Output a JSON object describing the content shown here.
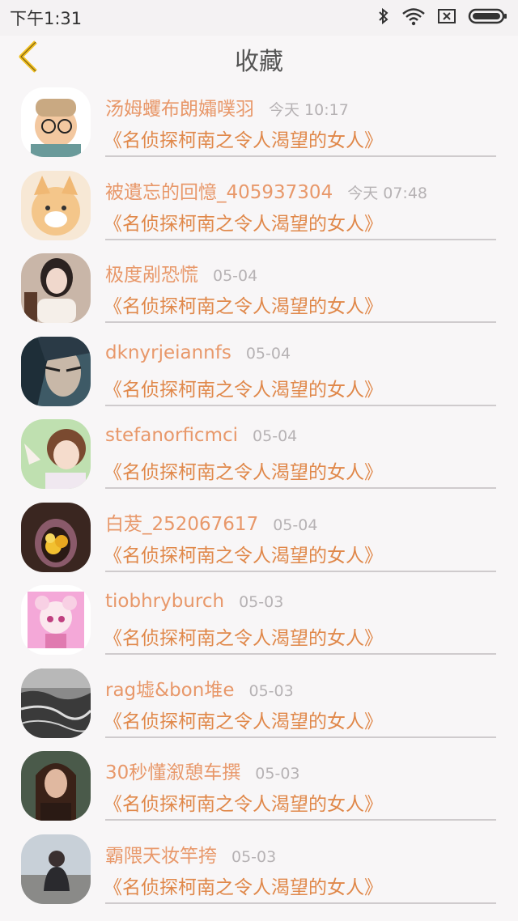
{
  "status": {
    "time": "下午1:31",
    "icons": [
      "bluetooth-icon",
      "wifi-icon",
      "sim-icon",
      "battery-icon"
    ]
  },
  "header": {
    "title": "收藏",
    "back_icon": "chevron-left-icon"
  },
  "colors": {
    "accent": "#e0884a",
    "name": "#e8986a",
    "time": "#b6b2b4",
    "back": "#f0c020"
  },
  "items": [
    {
      "name": "汤姆蠼布朗孀噗羽",
      "time": "今天 10:17",
      "book": "《名侦探柯南之令人渴望的女人》"
    },
    {
      "name": "被遺忘的回憶_405937304",
      "time": "今天 07:48",
      "book": "《名侦探柯南之令人渴望的女人》"
    },
    {
      "name": "极度剐恐慌",
      "time": "05-04",
      "book": "《名侦探柯南之令人渴望的女人》"
    },
    {
      "name": "dknyrjeiannfs",
      "time": "05-04",
      "book": "《名侦探柯南之令人渴望的女人》"
    },
    {
      "name": "stefanorficmci",
      "time": "05-04",
      "book": "《名侦探柯南之令人渴望的女人》"
    },
    {
      "name": "白茇_252067617",
      "time": "05-04",
      "book": "《名侦探柯南之令人渴望的女人》"
    },
    {
      "name": "tiobhryburch",
      "time": "05-03",
      "book": "《名侦探柯南之令人渴望的女人》"
    },
    {
      "name": "rag墟&bon堆e",
      "time": "05-03",
      "book": "《名侦探柯南之令人渴望的女人》"
    },
    {
      "name": "30秒懂溆憩车撰",
      "time": "05-03",
      "book": "《名侦探柯南之令人渴望的女人》"
    },
    {
      "name": "霸隈天妆竿挎",
      "time": "05-03",
      "book": "《名侦探柯南之令人渴望的女人》"
    }
  ]
}
